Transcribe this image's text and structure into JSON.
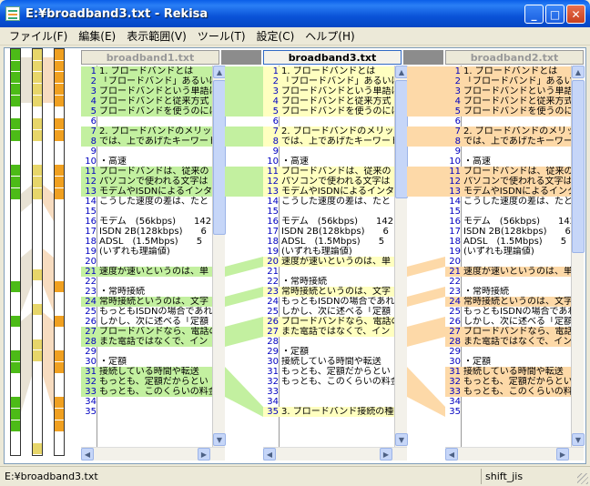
{
  "window": {
    "title": "E:¥broadband3.txt - Rekisa"
  },
  "window_buttons": {
    "minimize": "_",
    "maximize": "□",
    "close": "✕"
  },
  "icons": {
    "app": "rekisa-app-icon",
    "scroll_up": "arrow-up-icon",
    "scroll_down": "arrow-down-icon",
    "scroll_left": "arrow-left-icon",
    "scroll_right": "arrow-right-icon"
  },
  "colors": {
    "green": "#c3f0a0",
    "green_strong": "#4cbb17",
    "yellow": "#ffffc0",
    "orange": "#fdd9a8",
    "orange_strong": "#f0a020",
    "gap": "#8c8c8c"
  },
  "menu": [
    "ファイル(F)",
    "編集(E)",
    "表示範囲(V)",
    "ツール(T)",
    "設定(C)",
    "ヘルプ(H)"
  ],
  "panes": [
    {
      "name": "broadband1.txt",
      "active": false,
      "lines": [
        {
          "n": "1",
          "t": "1. ブロードバンドとは",
          "c": "g"
        },
        {
          "n": "2",
          "t": "「ブロードバンド」あるいは「",
          "c": "g"
        },
        {
          "n": "3",
          "t": "ブロードバンドという単語は",
          "c": "g"
        },
        {
          "n": "4",
          "t": "ブロードバンドと従来方式",
          "c": "g"
        },
        {
          "n": "5",
          "t": "ブロードバンドを使うのには",
          "c": "g"
        },
        {
          "n": "6",
          "t": "",
          "c": ""
        },
        {
          "n": "7",
          "t": "2. ブロードバンドのメリット",
          "c": "g"
        },
        {
          "n": "8",
          "t": "では、上であげたキーワード",
          "c": "g"
        },
        {
          "n": "9",
          "t": "",
          "c": ""
        },
        {
          "n": "10",
          "t": "・高速",
          "c": ""
        },
        {
          "n": "11",
          "t": "ブロードバンドは、従来の",
          "c": "g"
        },
        {
          "n": "12",
          "t": "パソコンで使われる文字は",
          "c": "g"
        },
        {
          "n": "13",
          "t": "モデムやISDNによるインタ",
          "c": "g"
        },
        {
          "n": "14",
          "t": "こうした速度の差は、たと",
          "c": ""
        },
        {
          "n": "15",
          "t": "",
          "c": ""
        },
        {
          "n": "16",
          "t": "モデム　(56kbps)　　142",
          "c": ""
        },
        {
          "n": "17",
          "t": "ISDN 2B(128kbps)　　6",
          "c": ""
        },
        {
          "n": "18",
          "t": "ADSL　(1.5Mbps)　　5",
          "c": ""
        },
        {
          "n": "19",
          "t": "(いずれも理論値)",
          "c": ""
        },
        {
          "n": "20",
          "t": "",
          "c": ""
        },
        {
          "n": "21",
          "t": "速度が速いというのは、単",
          "c": "g"
        },
        {
          "n": "22",
          "t": "",
          "c": ""
        },
        {
          "n": "23",
          "t": "・常時接続",
          "c": ""
        },
        {
          "n": "24",
          "t": "常時接続というのは、文字",
          "c": "g"
        },
        {
          "n": "25",
          "t": "もっともISDNの場合であれ",
          "c": ""
        },
        {
          "n": "26",
          "t": "しかし、次に述べる「定額",
          "c": ""
        },
        {
          "n": "27",
          "t": "ブロードバンドなら、電話の",
          "c": "g"
        },
        {
          "n": "28",
          "t": "また電話ではなくで、イン",
          "c": "g"
        },
        {
          "n": "29",
          "t": "",
          "c": ""
        },
        {
          "n": "30",
          "t": "・定額",
          "c": ""
        },
        {
          "n": "31",
          "t": "接続している時間や転送",
          "c": "g"
        },
        {
          "n": "32",
          "t": "もっとも、定額だからとい",
          "c": "g"
        },
        {
          "n": "33",
          "t": "もっとも、このくらいの料金",
          "c": "g"
        },
        {
          "n": "34",
          "t": "",
          "c": ""
        },
        {
          "n": "35",
          "t": "",
          "c": ""
        }
      ]
    },
    {
      "name": "broadband3.txt",
      "active": true,
      "lines": [
        {
          "n": "1",
          "t": "1. ブロードバンドとは",
          "c": "y"
        },
        {
          "n": "2",
          "t": "「ブロードバンド」あるいは「",
          "c": "y"
        },
        {
          "n": "3",
          "t": "ブロードバンドという単語は",
          "c": "y"
        },
        {
          "n": "4",
          "t": "ブロードバンドと従来方式",
          "c": "y"
        },
        {
          "n": "5",
          "t": "ブロードバンドを使うのには",
          "c": "y"
        },
        {
          "n": "6",
          "t": "",
          "c": ""
        },
        {
          "n": "7",
          "t": "2. ブロードバンドのメリット",
          "c": "y"
        },
        {
          "n": "8",
          "t": "では、上であげたキーワード",
          "c": "y"
        },
        {
          "n": "9",
          "t": "",
          "c": ""
        },
        {
          "n": "10",
          "t": "・高速",
          "c": ""
        },
        {
          "n": "11",
          "t": "ブロードバンドは、従来の",
          "c": "y"
        },
        {
          "n": "12",
          "t": "パソコンで使われる文字は",
          "c": "y"
        },
        {
          "n": "13",
          "t": "モデムやISDNによるインタ",
          "c": "y"
        },
        {
          "n": "14",
          "t": "こうした速度の差は、たと",
          "c": ""
        },
        {
          "n": "15",
          "t": "",
          "c": ""
        },
        {
          "n": "16",
          "t": "モデム　(56kbps)　　142",
          "c": ""
        },
        {
          "n": "17",
          "t": "ISDN 2B(128kbps)　　6",
          "c": ""
        },
        {
          "n": "18",
          "t": "ADSL　(1.5Mbps)　　5",
          "c": ""
        },
        {
          "n": "19",
          "t": "(いずれも理論値)",
          "c": ""
        },
        {
          "n": "20",
          "t": "速度が速いというのは、単",
          "c": "y"
        },
        {
          "n": "21",
          "t": "",
          "c": ""
        },
        {
          "n": "22",
          "t": "・常時接続",
          "c": ""
        },
        {
          "n": "23",
          "t": "常時接続というのは、文字",
          "c": "y"
        },
        {
          "n": "24",
          "t": "もっともISDNの場合であれ",
          "c": ""
        },
        {
          "n": "25",
          "t": "しかし、次に述べる「定額",
          "c": ""
        },
        {
          "n": "26",
          "t": "ブロードバンドなら、電話の",
          "c": "y"
        },
        {
          "n": "27",
          "t": "また電話ではなくで、イン",
          "c": "y"
        },
        {
          "n": "28",
          "t": "",
          "c": ""
        },
        {
          "n": "29",
          "t": "・定額",
          "c": ""
        },
        {
          "n": "30",
          "t": "接続している時間や転送",
          "c": ""
        },
        {
          "n": "31",
          "t": "もっとも、定額だからとい",
          "c": ""
        },
        {
          "n": "32",
          "t": "もっとも、このくらいの料金",
          "c": ""
        },
        {
          "n": "33",
          "t": "",
          "c": ""
        },
        {
          "n": "34",
          "t": "",
          "c": ""
        },
        {
          "n": "35",
          "t": "3. ブロードバンド接続の種類",
          "c": "y"
        }
      ]
    },
    {
      "name": "broadband2.txt",
      "active": false,
      "lines": [
        {
          "n": "1",
          "t": "1. ブロードバンドとは",
          "c": "o"
        },
        {
          "n": "2",
          "t": "「ブロードバンド」あるいは「",
          "c": "o"
        },
        {
          "n": "3",
          "t": "ブロードバンドという単語は",
          "c": "o"
        },
        {
          "n": "4",
          "t": "ブロードバンドと従来方式",
          "c": "o"
        },
        {
          "n": "5",
          "t": "ブロードバンドを使うのには",
          "c": "o"
        },
        {
          "n": "6",
          "t": "",
          "c": ""
        },
        {
          "n": "7",
          "t": "2. ブロードバンドのメリット",
          "c": "o"
        },
        {
          "n": "8",
          "t": "では、上であげたキーワード",
          "c": "o"
        },
        {
          "n": "9",
          "t": "",
          "c": ""
        },
        {
          "n": "10",
          "t": "・高速",
          "c": ""
        },
        {
          "n": "11",
          "t": "ブロードバンドは、従来の",
          "c": "o"
        },
        {
          "n": "12",
          "t": "パソコンで使われる文字は",
          "c": "o"
        },
        {
          "n": "13",
          "t": "モデムやISDNによるインタ",
          "c": "o"
        },
        {
          "n": "14",
          "t": "こうした速度の差は、たと",
          "c": ""
        },
        {
          "n": "15",
          "t": "",
          "c": ""
        },
        {
          "n": "16",
          "t": "モデム　(56kbps)　　142",
          "c": ""
        },
        {
          "n": "17",
          "t": "ISDN 2B(128kbps)　　6",
          "c": ""
        },
        {
          "n": "18",
          "t": "ADSL　(1.5Mbps)　　5",
          "c": ""
        },
        {
          "n": "19",
          "t": "(いずれも理論値)",
          "c": ""
        },
        {
          "n": "20",
          "t": "",
          "c": ""
        },
        {
          "n": "21",
          "t": "速度が速いというのは、単",
          "c": "o"
        },
        {
          "n": "22",
          "t": "",
          "c": ""
        },
        {
          "n": "23",
          "t": "・常時接続",
          "c": ""
        },
        {
          "n": "24",
          "t": "常時接続というのは、文字",
          "c": "o"
        },
        {
          "n": "25",
          "t": "もっともISDNの場合であれ",
          "c": ""
        },
        {
          "n": "26",
          "t": "しかし、次に述べる「定額",
          "c": ""
        },
        {
          "n": "27",
          "t": "ブロードバンドなら、電話の",
          "c": "o"
        },
        {
          "n": "28",
          "t": "また電話ではなくで、イン",
          "c": "o"
        },
        {
          "n": "29",
          "t": "",
          "c": ""
        },
        {
          "n": "30",
          "t": "・定額",
          "c": ""
        },
        {
          "n": "31",
          "t": "接続している時間や転送",
          "c": "o"
        },
        {
          "n": "32",
          "t": "もっとも、定額だからとい",
          "c": "o"
        },
        {
          "n": "33",
          "t": "もっとも、このくらいの料金",
          "c": "o"
        },
        {
          "n": "34",
          "t": "",
          "c": ""
        },
        {
          "n": "35",
          "t": "",
          "c": ""
        }
      ]
    }
  ],
  "status": {
    "path": "E:¥broadband3.txt",
    "encoding": "shift_jis"
  }
}
